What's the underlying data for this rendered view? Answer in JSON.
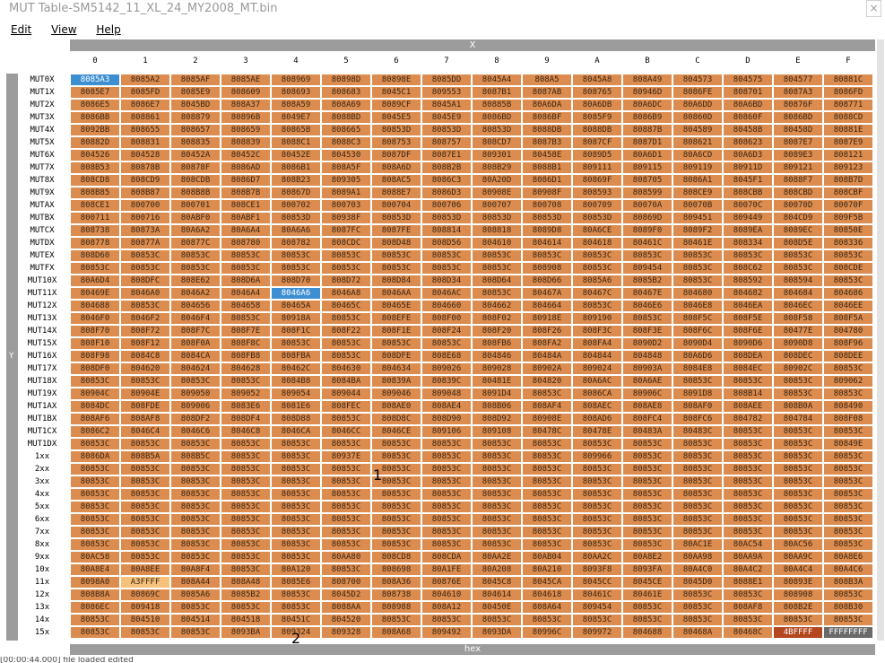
{
  "window": {
    "title": "MUT Table-SM5142_11_XL_24_MY2008_MT.bin",
    "close_glyph": "×"
  },
  "menu": [
    "Edit",
    "View",
    "Help"
  ],
  "x_axis_label": "X",
  "y_axis_label": "Y",
  "bottom_label": "hex",
  "status_text": "[00:00:44.000] file loaded edited",
  "annotations": [
    "1",
    "2"
  ],
  "columns": [
    "0",
    "1",
    "2",
    "3",
    "4",
    "5",
    "6",
    "7",
    "8",
    "9",
    "A",
    "B",
    "C",
    "D",
    "E",
    "F"
  ],
  "rows": [
    {
      "label": "MUT0X",
      "cells": [
        "8085A3",
        "8085A2",
        "8085AF",
        "8085AE",
        "808969",
        "80898D",
        "80898E",
        "8085DD",
        "8045A4",
        "808A5",
        "8045A8",
        "808A49",
        "804573",
        "804575",
        "804577",
        "80881C"
      ]
    },
    {
      "label": "MUT1X",
      "cells": [
        "8085E7",
        "8085FD",
        "8085E9",
        "808609",
        "808693",
        "808683",
        "8045C1",
        "809553",
        "8087B1",
        "8087AB",
        "808765",
        "80946D",
        "8086FE",
        "808701",
        "8087A3",
        "8086FD"
      ]
    },
    {
      "label": "MUT2X",
      "cells": [
        "8086E5",
        "8086E7",
        "8045BD",
        "808A37",
        "808A59",
        "808A69",
        "8089CF",
        "8045A1",
        "80885B",
        "80A6DA",
        "80A6DB",
        "80A6DC",
        "80A6DD",
        "80A6BD",
        "80876F",
        "808771"
      ]
    },
    {
      "label": "MUT3X",
      "cells": [
        "8086BB",
        "808861",
        "808879",
        "80896B",
        "8049E7",
        "8088BD",
        "8045E5",
        "8045E9",
        "8086BD",
        "8086BF",
        "8085F9",
        "8086B9",
        "80860D",
        "80860F",
        "8086BD",
        "8088CD"
      ]
    },
    {
      "label": "MUT4X",
      "cells": [
        "8092BB",
        "808655",
        "808657",
        "808659",
        "80865B",
        "808665",
        "80853D",
        "80853D",
        "80853D",
        "8088DB",
        "8088DB",
        "80887B",
        "804589",
        "80458B",
        "80458D",
        "80881E"
      ]
    },
    {
      "label": "MUT5X",
      "cells": [
        "80882D",
        "808831",
        "808835",
        "808839",
        "8088C1",
        "8088C3",
        "808753",
        "808757",
        "808CD7",
        "8087B3",
        "8087CF",
        "8087D1",
        "808621",
        "808623",
        "8087E7",
        "8087E9"
      ]
    },
    {
      "label": "MUT6X",
      "cells": [
        "804526",
        "804528",
        "80452A",
        "80452C",
        "80452E",
        "804530",
        "8087DF",
        "8087E1",
        "809301",
        "80458E",
        "8089D5",
        "80A6D1",
        "80A6CD",
        "80A6D3",
        "8089E3",
        "808121"
      ]
    },
    {
      "label": "MUT7X",
      "cells": [
        "808B53",
        "80878B",
        "80878F",
        "8086AD",
        "8086B1",
        "808A5F",
        "808A6D",
        "808B2B",
        "808B29",
        "8088B1",
        "809111",
        "809115",
        "809119",
        "80911D",
        "809121",
        "809123"
      ]
    },
    {
      "label": "MUT8X",
      "cells": [
        "808CD8",
        "808CD9",
        "808CDB",
        "8086D7",
        "808B23",
        "809305",
        "808AC5",
        "8086C3",
        "80A20D",
        "8086D1",
        "80869F",
        "808705",
        "8086A1",
        "8045F1",
        "8088F7",
        "808B7D"
      ]
    },
    {
      "label": "MUT9X",
      "cells": [
        "808B85",
        "808B87",
        "808B8B",
        "808B7B",
        "80867D",
        "8089A1",
        "8088E7",
        "8086D3",
        "80908E",
        "80908F",
        "808593",
        "808599",
        "808CE9",
        "808CBB",
        "808CBD",
        "808CBF"
      ]
    },
    {
      "label": "MUTAX",
      "cells": [
        "808CE1",
        "800700",
        "800701",
        "808CE1",
        "800702",
        "800703",
        "800704",
        "800706",
        "800707",
        "800708",
        "800709",
        "80070A",
        "80070B",
        "80070C",
        "80070D",
        "80070F"
      ]
    },
    {
      "label": "MUTBX",
      "cells": [
        "800711",
        "800716",
        "80ABF0",
        "80ABF1",
        "80853D",
        "80938F",
        "80853D",
        "80853D",
        "80853D",
        "80853D",
        "80853D",
        "80869D",
        "809451",
        "809449",
        "804CD9",
        "809F5B"
      ]
    },
    {
      "label": "MUTCX",
      "cells": [
        "808738",
        "80873A",
        "80A6A2",
        "80A6A4",
        "80A6A6",
        "8087FC",
        "8087FE",
        "808814",
        "808818",
        "8089D8",
        "80A6CE",
        "8089F0",
        "8089F2",
        "8089EA",
        "8089EC",
        "80850E"
      ]
    },
    {
      "label": "MUTDX",
      "cells": [
        "808778",
        "80877A",
        "80877C",
        "808780",
        "808782",
        "808CDC",
        "808D48",
        "808D56",
        "804610",
        "804614",
        "804618",
        "80461C",
        "80461E",
        "808334",
        "808D5E",
        "808336"
      ]
    },
    {
      "label": "MUTEX",
      "cells": [
        "808D60",
        "80853C",
        "80853C",
        "80853C",
        "80853C",
        "80853C",
        "80853C",
        "80853C",
        "80853C",
        "80853C",
        "80853C",
        "80853C",
        "80853C",
        "80853C",
        "80853C",
        "80853C"
      ]
    },
    {
      "label": "MUTFX",
      "cells": [
        "80853C",
        "80853C",
        "80853C",
        "80853C",
        "80853C",
        "80853C",
        "80853C",
        "80853C",
        "80853C",
        "808908",
        "80853C",
        "809454",
        "80853C",
        "808C62",
        "80853C",
        "808CDE"
      ]
    },
    {
      "label": "MUT10X",
      "cells": [
        "80A6D4",
        "808DFC",
        "808E62",
        "808D6A",
        "808D70",
        "808D72",
        "808D84",
        "808D34",
        "808D64",
        "808D66",
        "8085A6",
        "8085B2",
        "80853C",
        "808592",
        "808594",
        "80853C"
      ]
    },
    {
      "label": "MUT11X",
      "cells": [
        "80469E",
        "8046A0",
        "8046A2",
        "8046A4",
        "8046A6",
        "8046A8",
        "8046AA",
        "8046AC",
        "80853C",
        "80467A",
        "80467C",
        "80467E",
        "804680",
        "804682",
        "804684",
        "804686"
      ]
    },
    {
      "label": "MUT12X",
      "cells": [
        "804688",
        "80853C",
        "804656",
        "804658",
        "80465A",
        "80465C",
        "80465E",
        "804660",
        "804662",
        "804664",
        "80853C",
        "8046E6",
        "8046E8",
        "8046EA",
        "8046EC",
        "8046EE"
      ]
    },
    {
      "label": "MUT13X",
      "cells": [
        "8046F0",
        "8046F2",
        "8046F4",
        "80853C",
        "80918A",
        "80853C",
        "808EFE",
        "808F00",
        "808F02",
        "80918E",
        "809190",
        "80853C",
        "808F5C",
        "808F5E",
        "808F58",
        "808F5A"
      ]
    },
    {
      "label": "MUT14X",
      "cells": [
        "808F70",
        "808F72",
        "808F7C",
        "808F7E",
        "808F1C",
        "808F22",
        "808F1E",
        "808F24",
        "808F20",
        "808F26",
        "808F3C",
        "808F3E",
        "808F6C",
        "808F6E",
        "80477E",
        "804780"
      ]
    },
    {
      "label": "MUT15X",
      "cells": [
        "808F10",
        "808F12",
        "808F0A",
        "808F8C",
        "80853C",
        "80853C",
        "80853C",
        "80853C",
        "808FB6",
        "808FA2",
        "808FA4",
        "8090D2",
        "8090D4",
        "8090D6",
        "8090D8",
        "808F96"
      ]
    },
    {
      "label": "MUT16X",
      "cells": [
        "808F98",
        "8084C8",
        "8084CA",
        "808FB8",
        "808FBA",
        "80853C",
        "808DFE",
        "808E68",
        "804846",
        "80484A",
        "804844",
        "804848",
        "80A6D6",
        "808DEA",
        "808DEC",
        "808DEE"
      ]
    },
    {
      "label": "MUT17X",
      "cells": [
        "808DF0",
        "804620",
        "804624",
        "804628",
        "80462C",
        "804630",
        "804634",
        "809026",
        "809028",
        "80902A",
        "809024",
        "80903A",
        "8084E8",
        "8084EC",
        "80902C",
        "80853C"
      ]
    },
    {
      "label": "MUT18X",
      "cells": [
        "80853C",
        "80853C",
        "80853C",
        "80853C",
        "8084B8",
        "8084BA",
        "80839A",
        "80839C",
        "80481E",
        "804820",
        "80A6AC",
        "80A6AE",
        "80853C",
        "80853C",
        "80853C",
        "809062"
      ]
    },
    {
      "label": "MUT19X",
      "cells": [
        "80904C",
        "80904E",
        "809050",
        "809052",
        "809054",
        "809044",
        "809046",
        "809048",
        "8091D4",
        "80853C",
        "8086CA",
        "80906C",
        "8091D8",
        "808B14",
        "80853C",
        "80853C"
      ]
    },
    {
      "label": "MUT1AX",
      "cells": [
        "8084DC",
        "808FDE",
        "809006",
        "8083E6",
        "8081E6",
        "808FEC",
        "808AE0",
        "808AE4",
        "808B06",
        "808AF4",
        "808AEC",
        "808AE8",
        "808AF0",
        "808AEE",
        "808B0A",
        "808490"
      ]
    },
    {
      "label": "MUT1BX",
      "cells": [
        "808AF6",
        "808AF8",
        "808DF2",
        "808DF4",
        "808D88",
        "80853C",
        "808D8C",
        "808D90",
        "808D92",
        "80908E",
        "808AD6",
        "808FC4",
        "808FC6",
        "804782",
        "804784",
        "808F08"
      ]
    },
    {
      "label": "MUT1CX",
      "cells": [
        "8086C2",
        "8046C4",
        "8046C6",
        "8046C8",
        "8046CA",
        "8046CC",
        "8046CE",
        "809106",
        "809108",
        "80478C",
        "80478E",
        "80483A",
        "80483C",
        "80853C",
        "80853C",
        "80853C"
      ]
    },
    {
      "label": "MUT1DX",
      "cells": [
        "80853C",
        "80853C",
        "80853C",
        "80853C",
        "80853C",
        "80853C",
        "80853C",
        "80853C",
        "80853C",
        "80853C",
        "80853C",
        "80853C",
        "80853C",
        "80853C",
        "80853C",
        "80849E"
      ]
    },
    {
      "label": "1xx",
      "cells": [
        "8086DA",
        "808B5A",
        "808B5C",
        "80853C",
        "80853C",
        "80937E",
        "80853C",
        "80853C",
        "80853C",
        "80853C",
        "809966",
        "80853C",
        "80853C",
        "80853C",
        "80853C",
        "80853C"
      ]
    },
    {
      "label": "2xx",
      "cells": [
        "80853C",
        "80853C",
        "80853C",
        "80853C",
        "80853C",
        "80853C",
        "80853C",
        "80853C",
        "80853C",
        "80853C",
        "80853C",
        "80853C",
        "80853C",
        "80853C",
        "80853C",
        "80853C"
      ]
    },
    {
      "label": "3xx",
      "cells": [
        "80853C",
        "80853C",
        "80853C",
        "80853C",
        "80853C",
        "80853C",
        "80853C",
        "80853C",
        "80853C",
        "80853C",
        "80853C",
        "80853C",
        "80853C",
        "80853C",
        "80853C",
        "80853C"
      ]
    },
    {
      "label": "4xx",
      "cells": [
        "80853C",
        "80853C",
        "80853C",
        "80853C",
        "80853C",
        "80853C",
        "80853C",
        "80853C",
        "80853C",
        "80853C",
        "80853C",
        "80853C",
        "80853C",
        "80853C",
        "80853C",
        "80853C"
      ]
    },
    {
      "label": "5xx",
      "cells": [
        "80853C",
        "80853C",
        "80853C",
        "80853C",
        "80853C",
        "80853C",
        "80853C",
        "80853C",
        "80853C",
        "80853C",
        "80853C",
        "80853C",
        "80853C",
        "80853C",
        "80853C",
        "80853C"
      ]
    },
    {
      "label": "6xx",
      "cells": [
        "80853C",
        "80853C",
        "80853C",
        "80853C",
        "80853C",
        "80853C",
        "80853C",
        "80853C",
        "80853C",
        "80853C",
        "80853C",
        "80853C",
        "80853C",
        "80853C",
        "80853C",
        "80853C"
      ]
    },
    {
      "label": "7xx",
      "cells": [
        "80853C",
        "80853C",
        "80853C",
        "80853C",
        "80853C",
        "80853C",
        "80853C",
        "80853C",
        "80853C",
        "80853C",
        "80853C",
        "80853C",
        "80853C",
        "80853C",
        "80853C",
        "80853C"
      ]
    },
    {
      "label": "8xx",
      "cells": [
        "80853C",
        "80853C",
        "80853C",
        "80853C",
        "80853C",
        "80853C",
        "80853C",
        "80853C",
        "80853C",
        "80853C",
        "80853C",
        "80853C",
        "80AC1E",
        "80AC54",
        "80AC56",
        "80853C"
      ]
    },
    {
      "label": "9xx",
      "cells": [
        "80AC58",
        "80853C",
        "80853C",
        "80853C",
        "80853C",
        "80AA80",
        "808CD8",
        "808CDA",
        "80AA2E",
        "80AB04",
        "80AA2C",
        "80A8E2",
        "80AA98",
        "80AA9A",
        "80AA9C",
        "80A8E6"
      ]
    },
    {
      "label": "10x",
      "cells": [
        "80A8E4",
        "80A8EE",
        "80A8F4",
        "80853C",
        "80A120",
        "80853C",
        "808698",
        "80A1FE",
        "80A208",
        "80A210",
        "8093F8",
        "8093FA",
        "80A4C0",
        "80A4C2",
        "80A4C4",
        "80A4C6"
      ]
    },
    {
      "label": "11x",
      "cells": [
        "8098A0",
        "A3FFFF",
        "808A44",
        "808A48",
        "8085E6",
        "808700",
        "808A36",
        "80876E",
        "8045C8",
        "8045CA",
        "8045CC",
        "8045CE",
        "8045D0",
        "8088E1",
        "80893E",
        "808B3A"
      ]
    },
    {
      "label": "12x",
      "cells": [
        "808B8A",
        "80869C",
        "8085A6",
        "8085B2",
        "80853C",
        "8045D2",
        "808738",
        "804610",
        "804614",
        "804618",
        "80461C",
        "80461E",
        "80853C",
        "80853C",
        "808908",
        "80853C"
      ]
    },
    {
      "label": "13x",
      "cells": [
        "8086EC",
        "809418",
        "80853C",
        "80853C",
        "80853C",
        "8088AA",
        "808988",
        "808A12",
        "80450E",
        "808A64",
        "809454",
        "80853C",
        "80853C",
        "808AF8",
        "808B2E",
        "808B30"
      ]
    },
    {
      "label": "14x",
      "cells": [
        "80853C",
        "804510",
        "804514",
        "804518",
        "80451C",
        "804520",
        "80853C",
        "80853C",
        "80853C",
        "80853C",
        "80853C",
        "80853C",
        "80853C",
        "80853C",
        "80853C",
        "80853C"
      ]
    },
    {
      "label": "15x",
      "cells": [
        "80853C",
        "80853C",
        "80853C",
        "8093BA",
        "809324",
        "809328",
        "808A68",
        "809492",
        "8093DA",
        "80996C",
        "809972",
        "804688",
        "80468A",
        "80468C",
        "4BFFFF",
        "FFFFFFFF"
      ]
    }
  ]
}
